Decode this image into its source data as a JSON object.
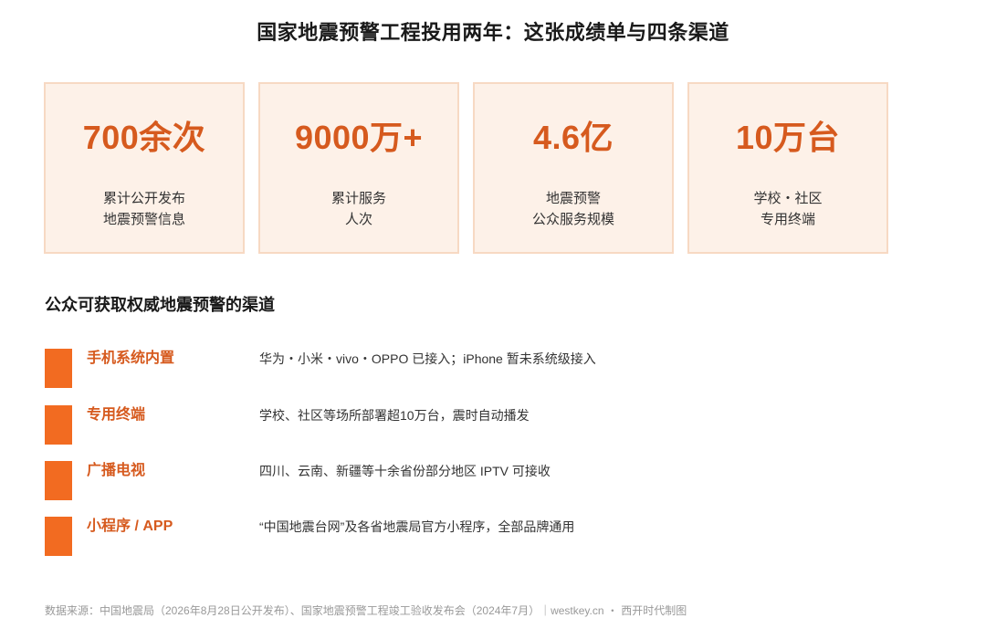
{
  "title": "国家地震预警工程投用两年：这张成绩单与四条渠道",
  "stats": [
    {
      "value": "700余次",
      "label_line1": "累计公开发布",
      "label_line2": "地震预警信息"
    },
    {
      "value": "9000万+",
      "label_line1": "累计服务",
      "label_line2": "人次"
    },
    {
      "value": "4.6亿",
      "label_line1": "地震预警",
      "label_line2": "公众服务规模"
    },
    {
      "value": "10万台",
      "label_line1": "学校・社区",
      "label_line2": "专用终端"
    }
  ],
  "section_title": "公众可获取权威地震预警的渠道",
  "channels": [
    {
      "name": "手机系统内置",
      "desc": "华为・小米・vivo・OPPO 已接入；iPhone 暂未系统级接入"
    },
    {
      "name": "专用终端",
      "desc": "学校、社区等场所部署超10万台，震时自动播发"
    },
    {
      "name": "广播电视",
      "desc": "四川、云南、新疆等十余省份部分地区 IPTV 可接收"
    },
    {
      "name": "小程序 / APP",
      "desc": "“中国地震台网”及各省地震局官方小程序，全部品牌通用"
    }
  ],
  "footer": "数据来源：中国地震局（2026年8月28日公开发布）、国家地震预警工程竣工验收发布会（2024年7月）｜westkey.cn ・ 西开时代制图",
  "colors": {
    "accent": "#d65a1e",
    "bar": "#f26b21",
    "card_bg": "#fdf1e8",
    "card_border": "#f7d9c3"
  }
}
